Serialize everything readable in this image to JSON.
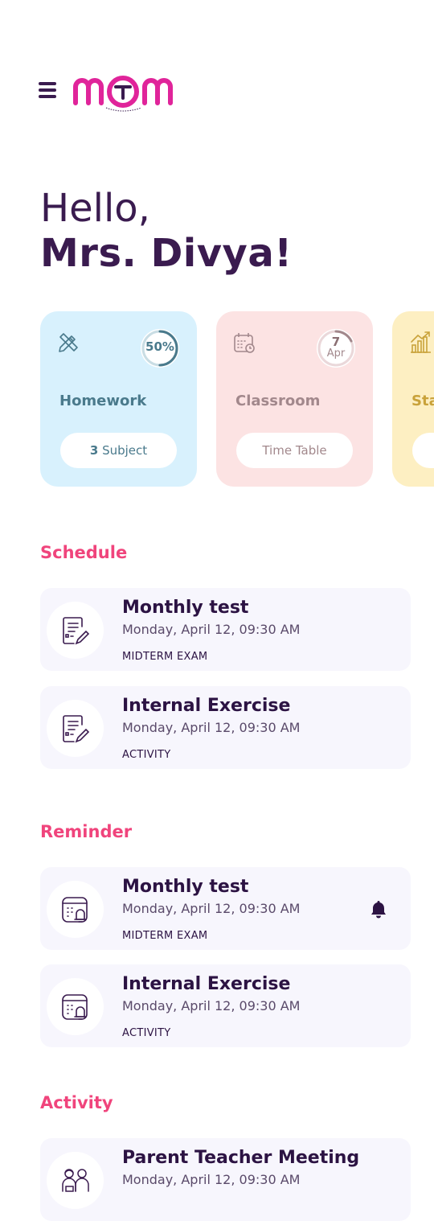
{
  "header": {
    "menu_icon": "hamburger-menu-icon",
    "logo_icon": "mtm-logo-icon",
    "logo_tagline": "Connecting Parents with Teachers"
  },
  "greeting": {
    "hello": "Hello,",
    "name": "Mrs. Divya!"
  },
  "cards": [
    {
      "title": "Homework",
      "icon": "pencil-ruler-icon",
      "badge": "50%",
      "progress": 0.5,
      "pill_count": "3",
      "pill_text": " Subject",
      "bg": "#d8f1fd",
      "accent": "#4a7a8c"
    },
    {
      "title": "Classroom",
      "icon": "calendar-clock-icon",
      "badge_day": "7",
      "badge_month": "Apr",
      "pill_text": "Time Table",
      "bg": "#fce3e3",
      "accent": "#a2888c"
    },
    {
      "title": "Sta",
      "icon": "bar-chart-icon",
      "bg": "#fdefc2",
      "accent": "#c9a23a"
    }
  ],
  "schedule": {
    "heading": "Schedule",
    "items": [
      {
        "title": "Monthly test",
        "date": "Monday,  April 12, 09:30 AM",
        "tag": "MIDTERM EXAM"
      },
      {
        "title": "Internal Exercise",
        "date": "Monday,  April 12, 09:30 AM",
        "tag": "ACTIVITY"
      }
    ]
  },
  "reminder": {
    "heading": "Reminder",
    "items": [
      {
        "title": "Monthly test",
        "date": "Monday,  April 12, 09:30 AM",
        "tag": "MIDTERM EXAM"
      },
      {
        "title": "Internal Exercise",
        "date": "Monday,  April 12, 09:30 AM",
        "tag": "ACTIVITY"
      }
    ]
  },
  "activity": {
    "heading": "Activity",
    "items": [
      {
        "title": "Parent Teacher Meeting",
        "date": "Monday,  April 12, 09:30 AM"
      }
    ]
  },
  "colors": {
    "brand_purple": "#3a1b4f",
    "accent_pink": "#f0447c",
    "logo_magenta": "#e0249a"
  }
}
